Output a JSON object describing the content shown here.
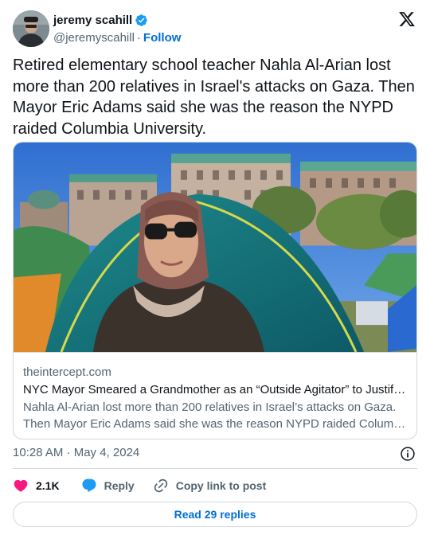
{
  "author": {
    "name": "jeremy scahill",
    "handle": "@jeremyscahill",
    "separator": "·",
    "follow_label": "Follow"
  },
  "tweet": {
    "text": "Retired elementary school teacher Nahla Al-Arian lost more than 200 relatives in Israel's attacks on Gaza. Then Mayor Eric Adams said she was the reason the NYPD raided Columbia University."
  },
  "link_card": {
    "domain": "theintercept.com",
    "title": "NYC Mayor Smeared a Grandmother as an “Outside Agitator” to Justify…",
    "description_line1": "Nahla Al-Arian lost more than 200 relatives in Israel’s attacks on Gaza.",
    "description_line2": "Then Mayor Eric Adams said she was the reason NYPD raided Columb…"
  },
  "meta": {
    "timestamp": "10:28 AM · May 4, 2024"
  },
  "actions": {
    "like_count": "2.1K",
    "reply_label": "Reply",
    "copy_label": "Copy link to post"
  },
  "footer": {
    "read_replies_label": "Read 29 replies"
  },
  "colors": {
    "like": "#f91880",
    "reply": "#1d9bf0",
    "link_blue": "#006fd6",
    "verified": "#1d9bf0",
    "secondary_text": "#536471",
    "border": "#cfd9de"
  },
  "icons": [
    "verified-badge-icon",
    "x-logo-icon",
    "info-icon",
    "heart-icon",
    "speech-bubble-icon",
    "link-icon"
  ]
}
